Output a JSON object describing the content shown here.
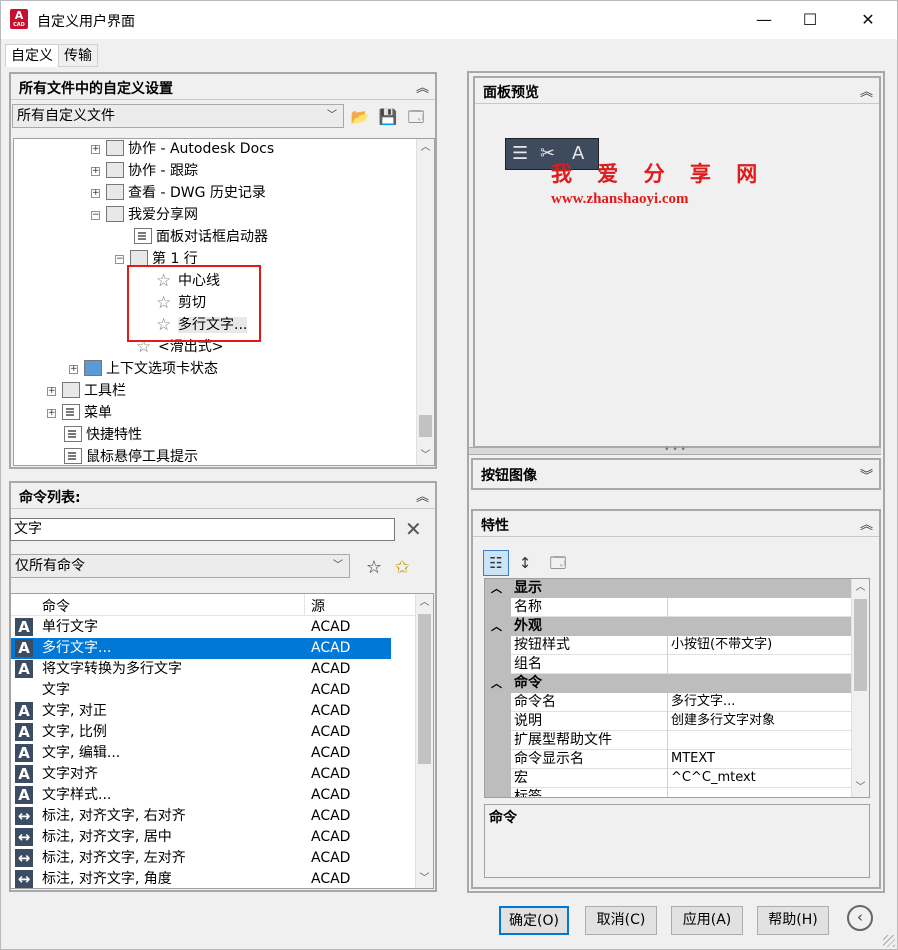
{
  "window": {
    "title": "自定义用户界面",
    "minimize": "—",
    "maximize": "☐",
    "close": "✕",
    "app_icon": "A",
    "app_icon_sub": "CAD"
  },
  "tabs": [
    {
      "label": "自定义"
    },
    {
      "label": "传输"
    }
  ],
  "left_panel": {
    "title": "所有文件中的自定义设置",
    "file_combo": "所有自定义文件",
    "tree": [
      {
        "label": "协作 - Autodesk Docs"
      },
      {
        "label": "协作 - 跟踪"
      },
      {
        "label": "查看 - DWG 历史记录"
      },
      {
        "label": "我爱分享网"
      },
      {
        "label": "面板对话框启动器"
      },
      {
        "label": "第 1 行"
      },
      {
        "label": "中心线"
      },
      {
        "label": "剪切"
      },
      {
        "label": "多行文字..."
      },
      {
        "label": "<滑出式>"
      },
      {
        "label": "上下文选项卡状态"
      },
      {
        "label": "工具栏"
      },
      {
        "label": "菜单"
      },
      {
        "label": "快捷特性"
      },
      {
        "label": "鼠标悬停工具提示"
      }
    ]
  },
  "command_panel": {
    "title": "命令列表:",
    "search_value": "文字",
    "filter_combo": "仅所有命令",
    "columns": {
      "name": "命令",
      "source": "源"
    },
    "rows": [
      {
        "name": "单行文字",
        "source": "ACAD"
      },
      {
        "name": "多行文字...",
        "source": "ACAD"
      },
      {
        "name": "将文字转换为多行文字",
        "source": "ACAD"
      },
      {
        "name": "文字",
        "source": "ACAD"
      },
      {
        "name": "文字, 对正",
        "source": "ACAD"
      },
      {
        "name": "文字, 比例",
        "source": "ACAD"
      },
      {
        "name": "文字, 编辑...",
        "source": "ACAD"
      },
      {
        "name": "文字对齐",
        "source": "ACAD"
      },
      {
        "name": "文字样式...",
        "source": "ACAD"
      },
      {
        "name": "标注, 对齐文字, 右对齐",
        "source": "ACAD"
      },
      {
        "name": "标注, 对齐文字, 居中",
        "source": "ACAD"
      },
      {
        "name": "标注, 对齐文字, 左对齐",
        "source": "ACAD"
      },
      {
        "name": "标注, 对齐文字, 角度",
        "source": "ACAD"
      }
    ]
  },
  "preview_panel": {
    "title": "面板预览",
    "watermark_cn": "我 爱 分 享 网",
    "watermark_url": "www.zhanshaoyi.com"
  },
  "button_image_panel": {
    "title": "按钮图像"
  },
  "properties_panel": {
    "title": "特性",
    "categories": [
      {
        "label": "显示",
        "rows": [
          {
            "key": "名称",
            "value": ""
          }
        ]
      },
      {
        "label": "外观",
        "rows": [
          {
            "key": "按钮样式",
            "value": "小按钮(不带文字)"
          },
          {
            "key": "组名",
            "value": ""
          }
        ]
      },
      {
        "label": "命令",
        "rows": [
          {
            "key": "命令名",
            "value": "多行文字..."
          },
          {
            "key": "说明",
            "value": "创建多行文字对象"
          },
          {
            "key": "扩展型帮助文件",
            "value": ""
          },
          {
            "key": "命令显示名",
            "value": "MTEXT"
          },
          {
            "key": "宏",
            "value": "^C^C_mtext"
          },
          {
            "key": "标签",
            "value": ""
          }
        ]
      }
    ],
    "description_title": "命令"
  },
  "buttons": {
    "ok": "确定(O)",
    "cancel": "取消(C)",
    "apply": "应用(A)",
    "help": "帮助(H)"
  },
  "colors": {
    "selection": "#0078d7",
    "highlight_box": "#e01b1b",
    "watermark": "#e01b1b"
  }
}
